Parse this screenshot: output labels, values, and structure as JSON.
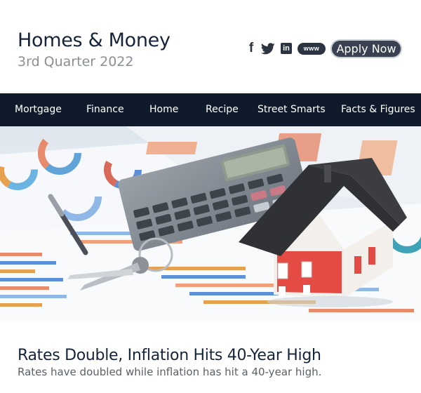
{
  "header": {
    "title": "Homes & Money",
    "subtitle": "3rd Quarter 2022",
    "apply_label": "Apply Now"
  },
  "social": {
    "facebook": "f",
    "twitter": "twitter",
    "linkedin": "in",
    "website": "www"
  },
  "nav": {
    "items": [
      "Mortgage",
      "Finance",
      "Home",
      "Recipe",
      "Street Smarts",
      "Facts & Figures"
    ]
  },
  "hero": {
    "icon": "house-with-keys-and-calculator-photo"
  },
  "article": {
    "headline": "Rates Double, Inflation Hits 40-Year High",
    "summary": "Rates have doubled while inflation has hit a 40-year high."
  },
  "colors": {
    "nav_background": "#0f1b2b",
    "button_background": "#3a4150",
    "title": "#16243a",
    "subtitle": "#8a8f96"
  }
}
